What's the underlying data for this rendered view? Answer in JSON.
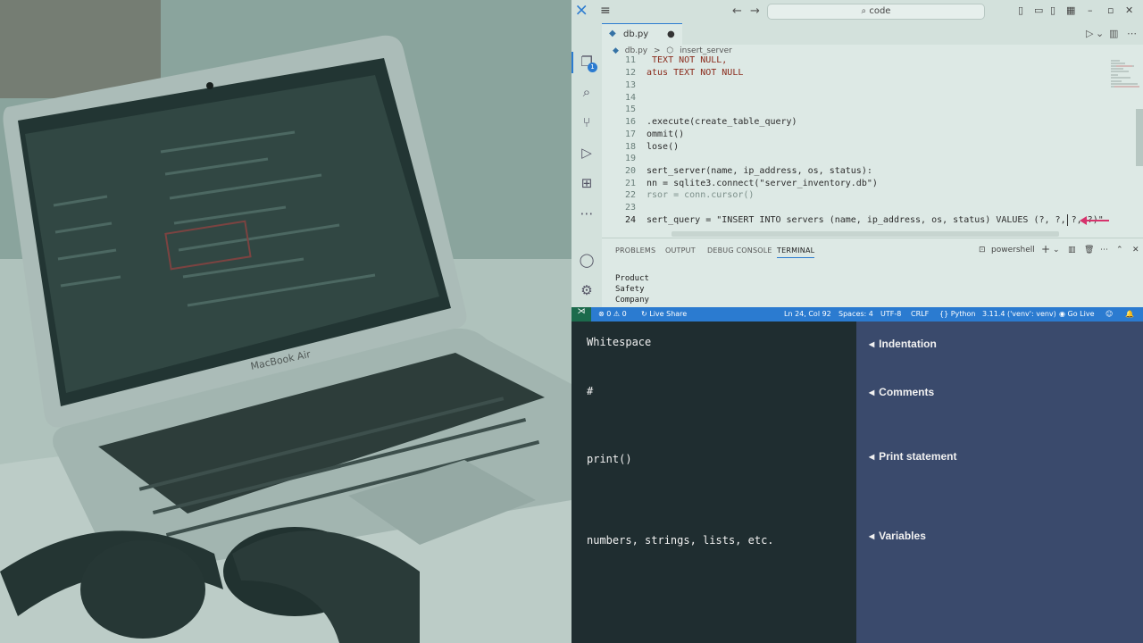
{
  "photo": {
    "laptop_brand": "MacBook Air"
  },
  "titlebar": {
    "menu_icon": "hamburger-icon",
    "back_icon": "arrow-left-icon",
    "forward_icon": "arrow-right-icon",
    "search_label": "code",
    "window_controls": [
      "minimize",
      "restore",
      "close"
    ]
  },
  "activity": {
    "items": [
      "explorer-icon",
      "search-icon",
      "source-control-icon",
      "run-debug-icon",
      "extensions-icon",
      "more-icon",
      "account-icon",
      "settings-icon"
    ],
    "explorer_badge": "1"
  },
  "tab": {
    "label": "db.py",
    "modified_dot": "●"
  },
  "breadcrumb": {
    "file": "db.py",
    "separator": ">",
    "symbol": "insert_server"
  },
  "editor": {
    "lines": [
      {
        "n": "11",
        "text": " TEXT NOT NULL,"
      },
      {
        "n": "12",
        "text": "atus TEXT NOT NULL"
      },
      {
        "n": "13",
        "text": ""
      },
      {
        "n": "14",
        "text": ""
      },
      {
        "n": "15",
        "text": ""
      },
      {
        "n": "16",
        "text": ".execute(create_table_query)"
      },
      {
        "n": "17",
        "text": "ommit()"
      },
      {
        "n": "18",
        "text": "lose()"
      },
      {
        "n": "19",
        "text": ""
      },
      {
        "n": "20",
        "text": "sert_server(name, ip_address, os, status):"
      },
      {
        "n": "21",
        "text": "nn = sqlite3.connect(\"server_inventory.db\")"
      },
      {
        "n": "22",
        "text": "rsor = conn.cursor()"
      },
      {
        "n": "23",
        "text": ""
      },
      {
        "n": "24",
        "text": "sert_query = \"INSERT INTO servers (name, ip_address, os, status) VALUES (?, ?, ?, ?)\""
      }
    ]
  },
  "panel": {
    "tabs": [
      "PROBLEMS",
      "OUTPUT",
      "DEBUG CONSOLE",
      "TERMINAL"
    ],
    "active_tab": "TERMINAL",
    "shell": "powershell",
    "terminal_lines": [
      "Product",
      "Safety",
      "Company"
    ]
  },
  "statusbar": {
    "errors": "0",
    "warnings": "0",
    "live_share": "Live Share",
    "position": "Ln 24, Col 92",
    "spaces": "Spaces: 4",
    "encoding": "UTF-8",
    "eol": "CRLF",
    "language": "Python",
    "interpreter": "3.11.4 ('venv': venv)",
    "go_live": "Go Live"
  },
  "notes": [
    {
      "code": "Whitespace",
      "label": "Indentation"
    },
    {
      "code": "#",
      "label": "Comments"
    },
    {
      "code": "print()",
      "label": "Print statement"
    },
    {
      "code": "numbers, strings, lists, etc.",
      "label": "Variables"
    }
  ],
  "colors": {
    "accent": "#2b7bd0",
    "arrow": "#d6336c",
    "notes_left_bg": "#1f2d30",
    "notes_right_bg": "#3a4a6c"
  }
}
